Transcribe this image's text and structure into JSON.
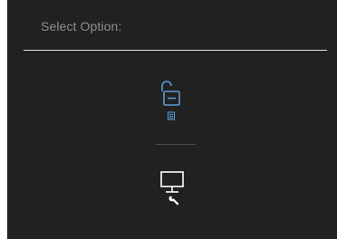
{
  "menu": {
    "prompt": "Select Option:",
    "options": [
      {
        "icon": "unlock-menu-icon",
        "accent": "#5b9bd5"
      },
      {
        "icon": "monitor-diagnostics-icon",
        "accent": "#ffffff"
      }
    ]
  },
  "colors": {
    "background": "#212121",
    "prompt_text": "#8f8f8f",
    "divider": "#e6e6e6",
    "selected_accent": "#5b9bd5"
  }
}
